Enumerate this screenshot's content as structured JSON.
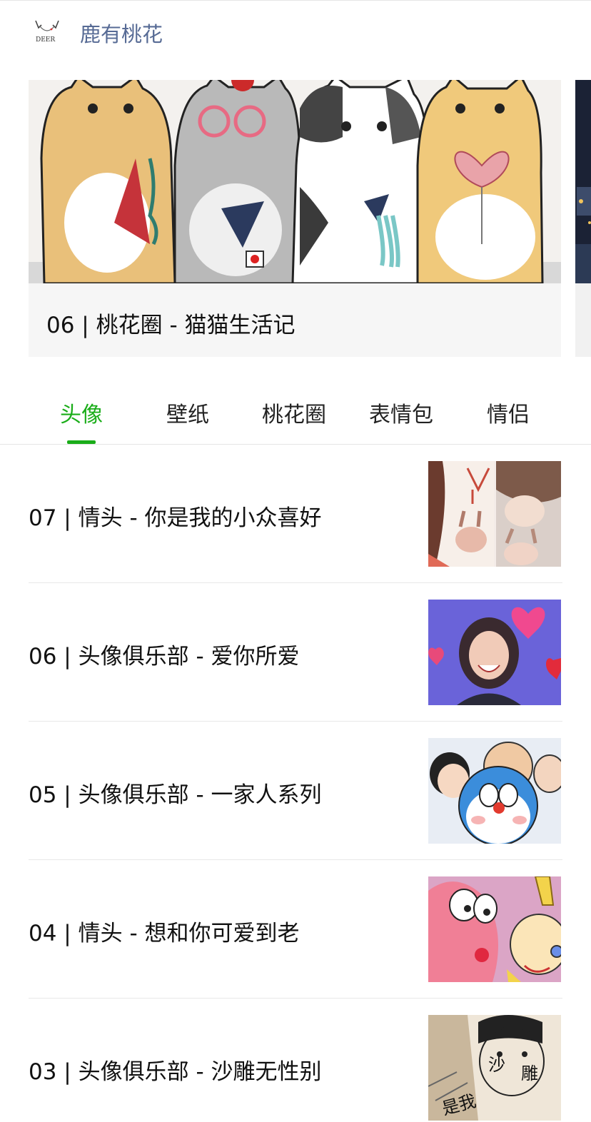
{
  "header": {
    "account_name": "鹿有桃花",
    "logo_text": "DEER"
  },
  "carousel": {
    "cards": [
      {
        "title": "06 | 桃花圈 - 猫猫生活记",
        "image": "cats-illustration"
      }
    ]
  },
  "tabs": [
    {
      "label": "头像",
      "active": true
    },
    {
      "label": "壁纸",
      "active": false
    },
    {
      "label": "桃花圈",
      "active": false
    },
    {
      "label": "表情包",
      "active": false
    },
    {
      "label": "情侣",
      "active": false
    }
  ],
  "articles": [
    {
      "title": "07 | 情头 - 你是我的小众喜好",
      "thumbnail": "bunny-couple-collage"
    },
    {
      "title": "06 | 头像俱乐部 - 爱你所爱",
      "thumbnail": "laughing-girl-hearts"
    },
    {
      "title": "05 | 头像俱乐部 - 一家人系列",
      "thumbnail": "doraemon-family"
    },
    {
      "title": "04 | 情头 - 想和你可爱到老",
      "thumbnail": "patrick-cartoon"
    },
    {
      "title": "03 | 头像俱乐部 - 沙雕无性别",
      "thumbnail": "sketch-boy-text"
    }
  ],
  "thumb_text": {
    "sketch_1": "沙",
    "sketch_2": "雕",
    "sketch_3": "是我"
  },
  "colors": {
    "accent_green": "#1aad19",
    "account_blue": "#576b95",
    "divider": "#e8e8e8"
  }
}
